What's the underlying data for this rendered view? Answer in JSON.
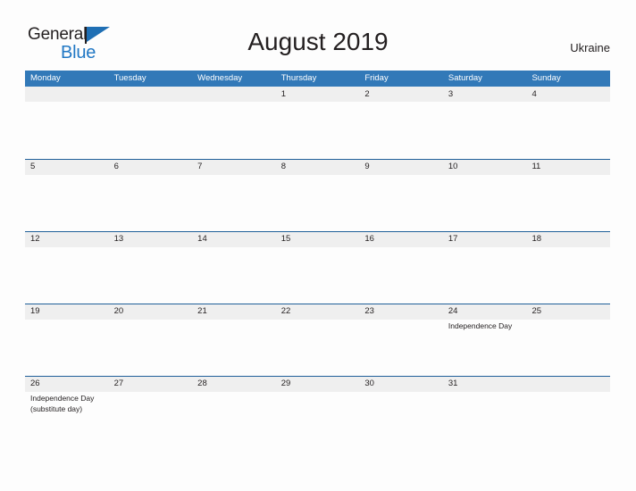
{
  "brand": {
    "name_part1": "General",
    "name_part2": "Blue",
    "flag_icon": "blue-flag-triangle"
  },
  "header": {
    "title": "August 2019",
    "country": "Ukraine"
  },
  "calendar": {
    "weekdays": [
      "Monday",
      "Tuesday",
      "Wednesday",
      "Thursday",
      "Friday",
      "Saturday",
      "Sunday"
    ],
    "accent_color": "#3279b8",
    "band_color": "#efefef",
    "rule_color": "#1f5f99",
    "weeks": [
      [
        {
          "day": "",
          "events": []
        },
        {
          "day": "",
          "events": []
        },
        {
          "day": "",
          "events": []
        },
        {
          "day": "1",
          "events": []
        },
        {
          "day": "2",
          "events": []
        },
        {
          "day": "3",
          "events": []
        },
        {
          "day": "4",
          "events": []
        }
      ],
      [
        {
          "day": "5",
          "events": []
        },
        {
          "day": "6",
          "events": []
        },
        {
          "day": "7",
          "events": []
        },
        {
          "day": "8",
          "events": []
        },
        {
          "day": "9",
          "events": []
        },
        {
          "day": "10",
          "events": []
        },
        {
          "day": "11",
          "events": []
        }
      ],
      [
        {
          "day": "12",
          "events": []
        },
        {
          "day": "13",
          "events": []
        },
        {
          "day": "14",
          "events": []
        },
        {
          "day": "15",
          "events": []
        },
        {
          "day": "16",
          "events": []
        },
        {
          "day": "17",
          "events": []
        },
        {
          "day": "18",
          "events": []
        }
      ],
      [
        {
          "day": "19",
          "events": []
        },
        {
          "day": "20",
          "events": []
        },
        {
          "day": "21",
          "events": []
        },
        {
          "day": "22",
          "events": []
        },
        {
          "day": "23",
          "events": []
        },
        {
          "day": "24",
          "events": [
            "Independence Day"
          ]
        },
        {
          "day": "25",
          "events": []
        }
      ],
      [
        {
          "day": "26",
          "events": [
            "Independence Day",
            "(substitute day)"
          ]
        },
        {
          "day": "27",
          "events": []
        },
        {
          "day": "28",
          "events": []
        },
        {
          "day": "29",
          "events": []
        },
        {
          "day": "30",
          "events": []
        },
        {
          "day": "31",
          "events": []
        },
        {
          "day": "",
          "events": []
        }
      ]
    ]
  }
}
